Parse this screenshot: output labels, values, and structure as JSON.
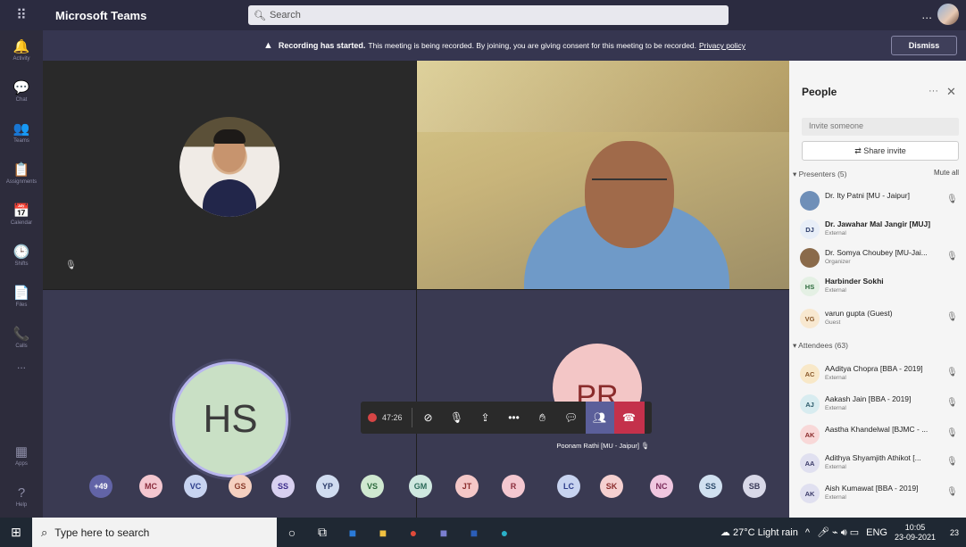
{
  "titlebar": {
    "app_name": "Microsoft Teams",
    "search_placeholder": "Search",
    "more": "..."
  },
  "rail": [
    {
      "label": "Activity",
      "icon": "bell-icon",
      "glyph": "🔔"
    },
    {
      "label": "Chat",
      "icon": "chat-icon",
      "glyph": "💬"
    },
    {
      "label": "Teams",
      "icon": "teams-icon",
      "glyph": "👥"
    },
    {
      "label": "Assignments",
      "icon": "assignments-icon",
      "glyph": "📋"
    },
    {
      "label": "Calendar",
      "icon": "calendar-icon",
      "glyph": "📅"
    },
    {
      "label": "Shifts",
      "icon": "shifts-icon",
      "glyph": "🕒"
    },
    {
      "label": "Files",
      "icon": "files-icon",
      "glyph": "📄"
    },
    {
      "label": "Calls",
      "icon": "calls-icon",
      "glyph": "📞"
    }
  ],
  "rail_more": "...",
  "rail_bottom": [
    {
      "label": "Apps",
      "icon": "apps-icon",
      "glyph": "▦"
    },
    {
      "label": "Help",
      "icon": "help-icon",
      "glyph": "?"
    }
  ],
  "banner": {
    "title": "Recording has started.",
    "text": "This meeting is being recorded. By joining, you are giving consent for this meeting to be recorded.",
    "link": "Privacy policy",
    "dismiss": "Dismiss"
  },
  "video": {
    "hs_initials": "HS",
    "pr_initials": "PR",
    "pr_name": "Poonam Rathi [MU - Jaipur]"
  },
  "controls": {
    "timer": "47:26",
    "more": "•••"
  },
  "strip": [
    {
      "initials": "+49",
      "bg": "#6264a7",
      "fg": "#ffffff"
    },
    {
      "initials": "MC",
      "bg": "#f4c7d0",
      "fg": "#8a2c3c"
    },
    {
      "initials": "VC",
      "bg": "#c7d3f0",
      "fg": "#2c3c8a"
    },
    {
      "initials": "GS",
      "bg": "#f5d0c0",
      "fg": "#8a3c2c"
    },
    {
      "initials": "SS",
      "bg": "#d8d0f0",
      "fg": "#3c2c8a"
    },
    {
      "initials": "YP",
      "bg": "#d0dcf0",
      "fg": "#2c3c6a"
    },
    {
      "initials": "VS",
      "bg": "#cfe8d0",
      "fg": "#2c6a3c"
    },
    {
      "initials": "GM",
      "bg": "#cfe8e0",
      "fg": "#2c6a5a"
    },
    {
      "initials": "JT",
      "bg": "#f4c7c7",
      "fg": "#8a2c2c"
    },
    {
      "initials": "R",
      "bg": "#f4c7d0",
      "fg": "#8a2c3c"
    },
    {
      "initials": "LC",
      "bg": "#c7d3f0",
      "fg": "#2c3c8a"
    },
    {
      "initials": "SK",
      "bg": "#f5d0d0",
      "fg": "#8a2c2c"
    },
    {
      "initials": "NC",
      "bg": "#f0c7e0",
      "fg": "#7a2c5a"
    },
    {
      "initials": "SS",
      "bg": "#d0e0f0",
      "fg": "#2c4a6a"
    },
    {
      "initials": "SB",
      "bg": "#d8d8e8",
      "fg": "#3c3c5a"
    }
  ],
  "panel": {
    "title": "People",
    "more": "···",
    "close": "✕",
    "invite_placeholder": "Invite someone",
    "share_invite": "Share invite",
    "presenters_header": "Presenters (5)",
    "mute_all": "Mute all",
    "presenters": [
      {
        "initials": "",
        "name": "Dr. Ity Patni [MU - Jaipur]",
        "sub": "",
        "bold": false,
        "photo": true,
        "bg": "#6f8fb8",
        "fg": "#fff",
        "status": "mic-off-icon"
      },
      {
        "initials": "DJ",
        "name": "Dr. Jawahar Mal Jangir [MUJ]",
        "sub": "External",
        "bold": true,
        "photo": false,
        "bg": "#e8eef8",
        "fg": "#2c3c6a",
        "status": ""
      },
      {
        "initials": "",
        "name": "Dr. Somya Choubey [MU-Jai...",
        "sub": "Organizer",
        "bold": false,
        "photo": true,
        "bg": "#8a6a4a",
        "fg": "#fff",
        "status": "mic-off-icon"
      },
      {
        "initials": "HS",
        "name": "Harbinder Sokhi",
        "sub": "External",
        "bold": true,
        "photo": false,
        "bg": "#e4f0e4",
        "fg": "#2c6a3c",
        "status": ""
      },
      {
        "initials": "VG",
        "name": "varun gupta (Guest)",
        "sub": "Guest",
        "bold": false,
        "photo": false,
        "bg": "#f8e8d0",
        "fg": "#8a5a2c",
        "status": "mic-off-icon"
      }
    ],
    "attendees_header": "Attendees (63)",
    "attendees": [
      {
        "initials": "AC",
        "name": "AAditya Chopra [BBA - 2019]",
        "sub": "External",
        "bg": "#f8e8c8",
        "fg": "#8a5a2c"
      },
      {
        "initials": "AJ",
        "name": "Aakash Jain [BBA - 2019]",
        "sub": "External",
        "bg": "#d8ecf0",
        "fg": "#2c5a6a"
      },
      {
        "initials": "AK",
        "name": "Aastha Khandelwal [BJMC - ...",
        "sub": "",
        "bg": "#f8d8d8",
        "fg": "#8a2c2c"
      },
      {
        "initials": "AA",
        "name": "Adithya Shyamjith Athikot [...",
        "sub": "External",
        "bg": "#e0e0f0",
        "fg": "#3c3c6a"
      },
      {
        "initials": "AK",
        "name": "Aish Kumawat [BBA - 2019]",
        "sub": "External",
        "bg": "#e0e0f0",
        "fg": "#3c3c6a"
      }
    ]
  },
  "taskbar": {
    "search_placeholder": "Type here to search",
    "weather": "27°C  Light rain",
    "lang": "ENG",
    "time": "10:05",
    "date": "23-09-2021",
    "notifications": "23"
  }
}
